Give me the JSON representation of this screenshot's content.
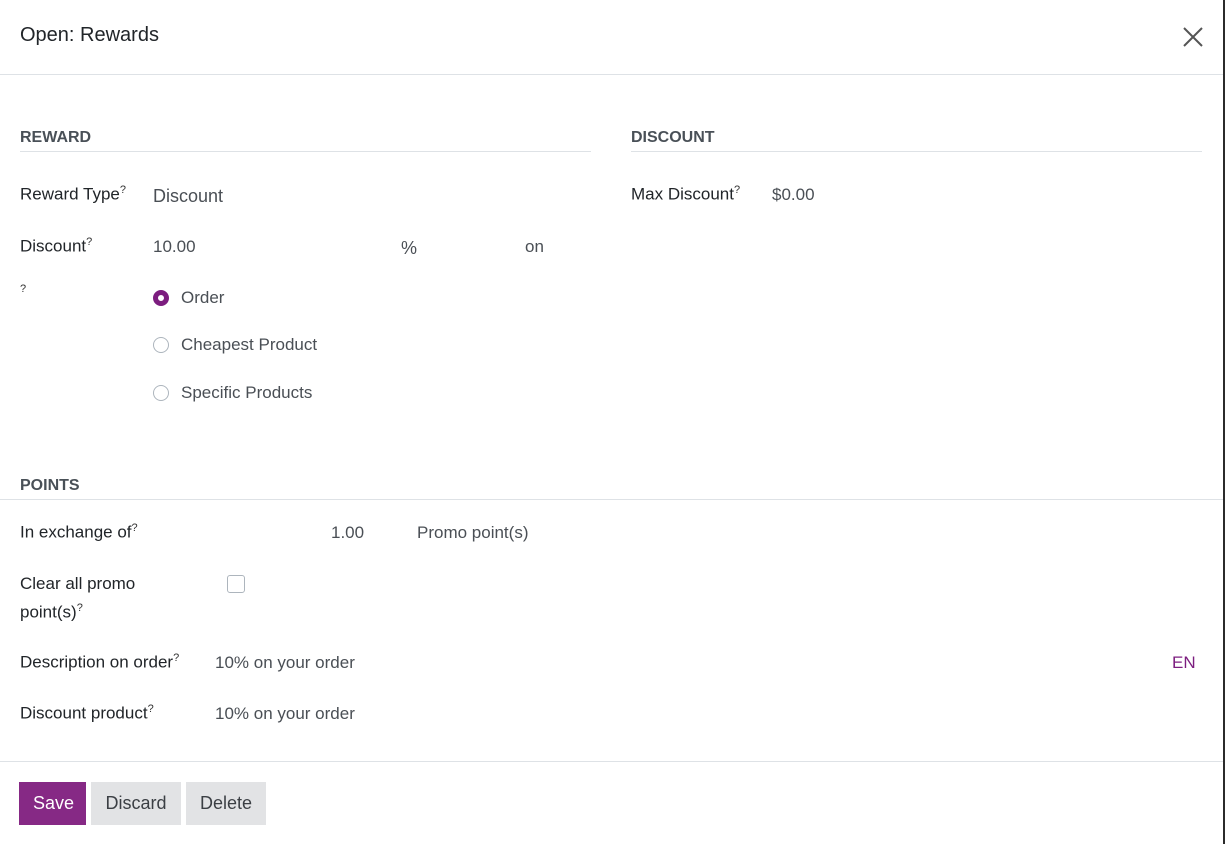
{
  "dialog": {
    "title": "Open: Rewards"
  },
  "sections": {
    "reward": "REWARD",
    "discount": "DISCOUNT",
    "points": "POINTS"
  },
  "reward": {
    "reward_type_label": "Reward Type",
    "reward_type_value": "Discount",
    "discount_label": "Discount",
    "discount_value": "10.00",
    "discount_unit": "%",
    "discount_on": "on",
    "applicability_label": "",
    "applicability_options": [
      "Order",
      "Cheapest Product",
      "Specific Products"
    ],
    "applicability_selected": "Order"
  },
  "discount": {
    "max_label": "Max Discount",
    "max_value": "$0.00"
  },
  "points": {
    "exchange_label": "In exchange of",
    "exchange_value": "1.00",
    "exchange_unit": "Promo point(s)",
    "clear_label_line1": "Clear all promo",
    "clear_label_line2": "point(s)",
    "clear_checked": false,
    "description_label": "Description on order",
    "description_value": "10% on your order",
    "lang": "EN",
    "product_label": "Discount product",
    "product_value": "10% on your order"
  },
  "tooltip_marker": "?",
  "footer": {
    "save": "Save",
    "discard": "Discard",
    "delete": "Delete"
  },
  "colors": {
    "accent": "#862985",
    "secondary_button": "#e2e3e5"
  },
  "icons": {
    "close": "close-icon"
  }
}
